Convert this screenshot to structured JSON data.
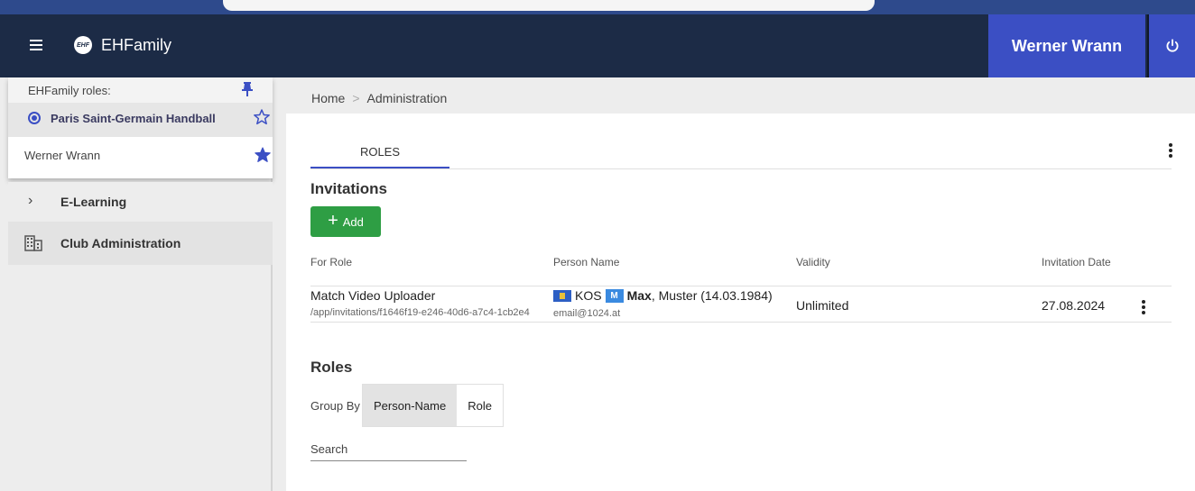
{
  "app": {
    "title": "EHFamily",
    "logo_text": "EHF"
  },
  "header": {
    "user_name": "Werner Wrann"
  },
  "sidebar": {
    "roles_label": "EHFamily roles:",
    "roles": [
      {
        "label": "Paris Saint-Germain Handball",
        "selected": true
      },
      {
        "label": "Werner Wrann",
        "selected": false
      }
    ],
    "nav": [
      {
        "label": "E-Learning"
      },
      {
        "label": "Club Administration"
      }
    ]
  },
  "breadcrumb": {
    "home": "Home",
    "separator": ">",
    "current": "Administration"
  },
  "tabs": [
    {
      "label": "ROLES",
      "active": true
    }
  ],
  "invitations": {
    "title": "Invitations",
    "add_label": "Add",
    "columns": {
      "role": "For Role",
      "person": "Person Name",
      "validity": "Validity",
      "date": "Invitation Date"
    },
    "rows": [
      {
        "role": "Match Video Uploader",
        "url": "/app/invitations/f1646f19-e246-40d6-a7c4-1cb2e4",
        "country": "KOS",
        "gender_badge": "M",
        "first_name": "Max",
        "rest_name": ", Muster (14.03.1984)",
        "email": "email@1024.at",
        "validity": "Unlimited",
        "date": "27.08.2024"
      }
    ]
  },
  "roles_section": {
    "title": "Roles",
    "group_by_label": "Group By",
    "group_by_options": [
      "Person-Name",
      "Role"
    ],
    "search_placeholder": "Search"
  },
  "colors": {
    "header_bg": "#1c2b46",
    "accent": "#3b4fc4",
    "add_button": "#2e9e44"
  }
}
